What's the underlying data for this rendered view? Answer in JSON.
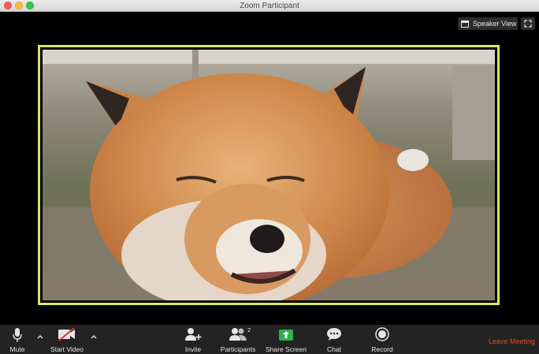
{
  "window": {
    "title": "Zoom Participant"
  },
  "view_controls": {
    "speaker_view_label": "Speaker View"
  },
  "video": {
    "border_color": "#d8e85c"
  },
  "toolbar": {
    "mute_label": "Mute",
    "start_video_label": "Start Video",
    "invite_label": "Invite",
    "participants_label": "Participants",
    "participants_count": "2",
    "share_screen_label": "Share Screen",
    "chat_label": "Chat",
    "record_label": "Record",
    "leave_label": "Leave Meeting",
    "share_color": "#2fb24c",
    "leave_color": "#e24a2e"
  }
}
